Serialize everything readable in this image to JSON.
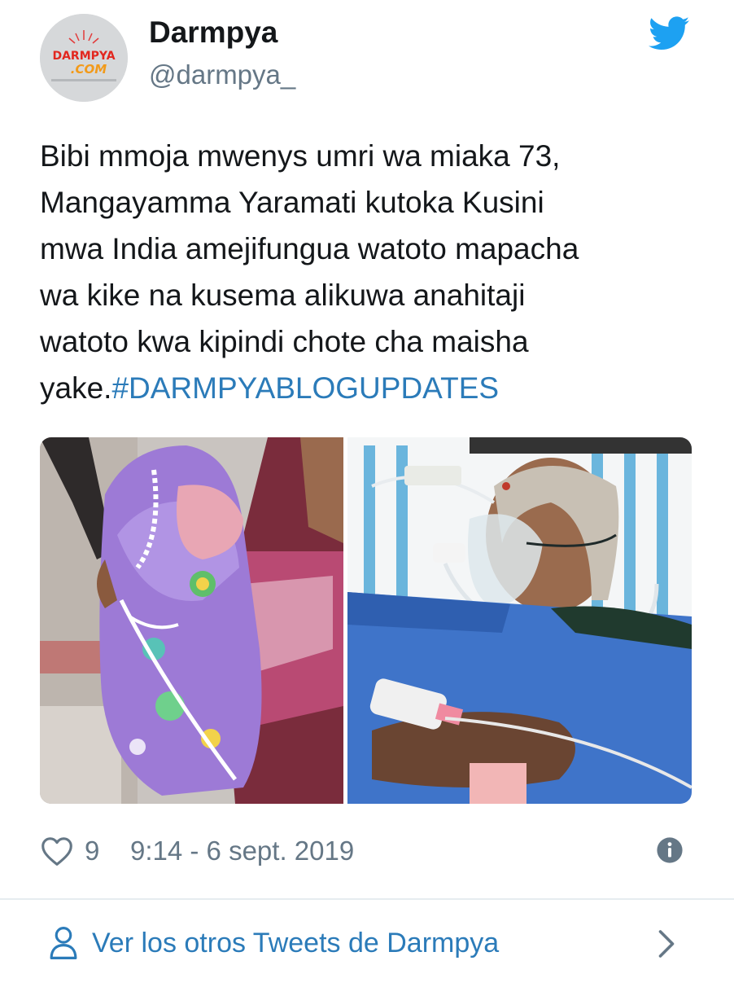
{
  "author": {
    "name": "Darmpya",
    "handle": "@darmpya_",
    "avatar_logo_text": "DARMPYA.COM"
  },
  "tweet": {
    "text": "Bibi mmoja mwenys umri wa miaka 73,\nMangayamma Yaramati kutoka Kusini\nmwa India amejifungua watoto mapacha\nwa kike na kusema alikuwa anahitaji\nwatoto kwa kipindi chote cha maisha\nyake.",
    "hashtag": "#DARMPYABLOGUPDATES"
  },
  "media": {
    "left": {
      "subject": "newborn-twins-photo"
    },
    "right": {
      "subject": "mother-hospital-photo"
    }
  },
  "meta": {
    "like_count": "9",
    "timestamp": "9:14 - 6 sept. 2019"
  },
  "footer": {
    "more_tweets_label": "Ver los otros Tweets de Darmpya"
  },
  "icons": {
    "brand": "twitter-bird-icon",
    "like": "heart-icon",
    "info": "info-icon",
    "profile": "person-icon",
    "chevron": "chevron-right-icon"
  },
  "colors": {
    "twitter_blue": "#1da1f2",
    "link_blue": "#2b7bb9",
    "muted_gray": "#657786",
    "text": "#14171a",
    "divider": "#e6ecf0"
  }
}
